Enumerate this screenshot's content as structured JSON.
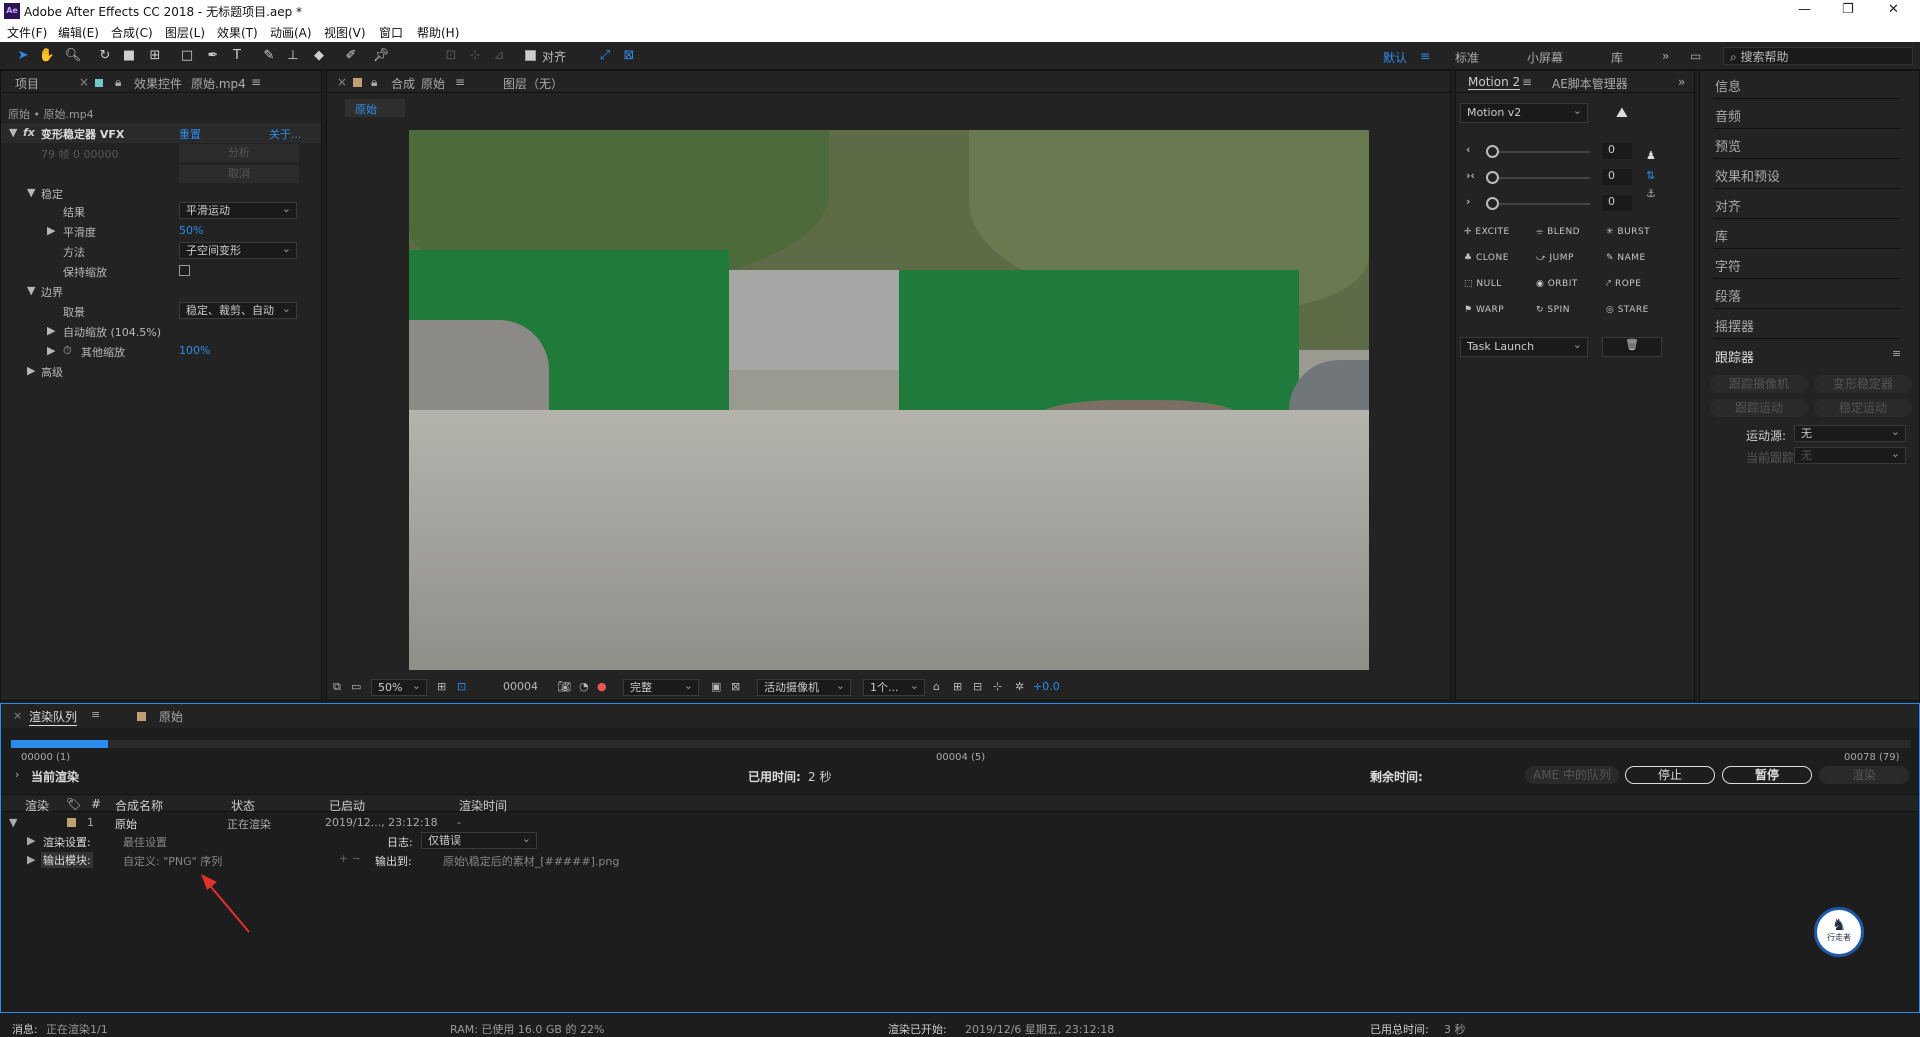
{
  "app": {
    "title": "Adobe After Effects CC 2018 - 无标题项目.aep *",
    "logo": "Ae",
    "min": "—",
    "max": "❐",
    "close": "✕"
  },
  "menu": [
    "文件(F)",
    "编辑(E)",
    "合成(C)",
    "图层(L)",
    "效果(T)",
    "动画(A)",
    "视图(V)",
    "窗口",
    "帮助(H)"
  ],
  "toolbar": {
    "align": "对齐",
    "workspaces": [
      "默认",
      "标准",
      "小屏幕",
      "库"
    ],
    "search": "搜索帮助"
  },
  "effects_panel": {
    "tab_project": "项目",
    "tab_effects_prefix": "效果控件",
    "tab_effects_file": "原始.mp4",
    "breadcrumb": "原始 • 原始.mp4",
    "fx_name": "变形稳定器 VFX",
    "reset": "重置",
    "about": "关于...",
    "frame_info": "79 帧 0 00000",
    "analyze": "分析",
    "cancel": "取消",
    "stabilize": "稳定",
    "result_label": "结果",
    "result_value": "平滑运动",
    "smoothness_label": "平滑度",
    "smoothness_value": "50%",
    "method_label": "方法",
    "method_value": "子空间变形",
    "keep_scale_label": "保持缩放",
    "borders": "边界",
    "framing_label": "取景",
    "framing_value": "稳定、裁剪、自动",
    "auto_scale": "自动缩放 (104.5%)",
    "other_scale_label": "其他缩放",
    "other_scale_value": "100%",
    "advanced": "高级"
  },
  "comp": {
    "tab_prefix": "合成",
    "tab_name": "原始",
    "layer": "图层（无）",
    "subtab": "原始",
    "zoom": "50%",
    "timecode": "00004",
    "quality": "完整",
    "camera": "活动摄像机",
    "views": "1个...",
    "exposure": "+0.0"
  },
  "motion": {
    "tab1": "Motion 2",
    "tab2": "AE脚本管理器",
    "preset": "Motion v2",
    "sliders": [
      "0",
      "0",
      "0"
    ],
    "buttons": [
      "EXCITE",
      "BLEND",
      "BURST",
      "CLONE",
      "JUMP",
      "NAME",
      "NULL",
      "ORBIT",
      "ROPE",
      "WARP",
      "SPIN",
      "STARE"
    ],
    "task": "Task Launch"
  },
  "right": {
    "items": [
      "信息",
      "音频",
      "预览",
      "效果和预设",
      "对齐",
      "库",
      "字符",
      "段落",
      "摇摆器"
    ],
    "tracker": "跟踪器",
    "track_camera": "跟踪摄像机",
    "warp_stab": "变形稳定器",
    "track_motion": "跟踪运动",
    "stabilize_motion": "稳定运动",
    "motion_source_label": "运动源:",
    "motion_source_value": "无",
    "current_track_label": "当前跟踪:",
    "current_track_value": "无"
  },
  "render": {
    "tab": "渲染队列",
    "comp_tab": "原始",
    "start_label": "00000 (1)",
    "mid_label": "00004 (5)",
    "end_label": "00078 (79)",
    "progress": 0.051,
    "current": "当前渲染",
    "elapsed_label": "已用时间:",
    "elapsed": "2 秒",
    "remaining_label": "剩余时间:",
    "ame": "AME 中的队列",
    "stop": "停止",
    "pause": "暂停",
    "render": "渲染",
    "cols": [
      "渲染",
      "#",
      "合成名称",
      "状态",
      "已启动",
      "渲染时间"
    ],
    "item": {
      "num": "1",
      "name": "原始",
      "status": "正在渲染",
      "started": "2019/12..., 23:12:18",
      "time": "-"
    },
    "settings_label": "渲染设置:",
    "settings_value": "最佳设置",
    "log_label": "日志:",
    "log_value": "仅错误",
    "output_label": "输出模块:",
    "output_value": "自定义: \"PNG\" 序列",
    "output_to_label": "输出到:",
    "output_to_value": "原始\\稳定后的素材_[#####].png",
    "status_msg_label": "消息:",
    "status_msg": "正在渲染1/1",
    "ram": "RAM: 已使用 16.0 GB 的 22%",
    "began_label": "渲染已开始:",
    "began": "2019/12/6 星期五, 23:12:18",
    "total_label": "已用总时间:",
    "total": "3 秒"
  },
  "watermark": "行走者"
}
